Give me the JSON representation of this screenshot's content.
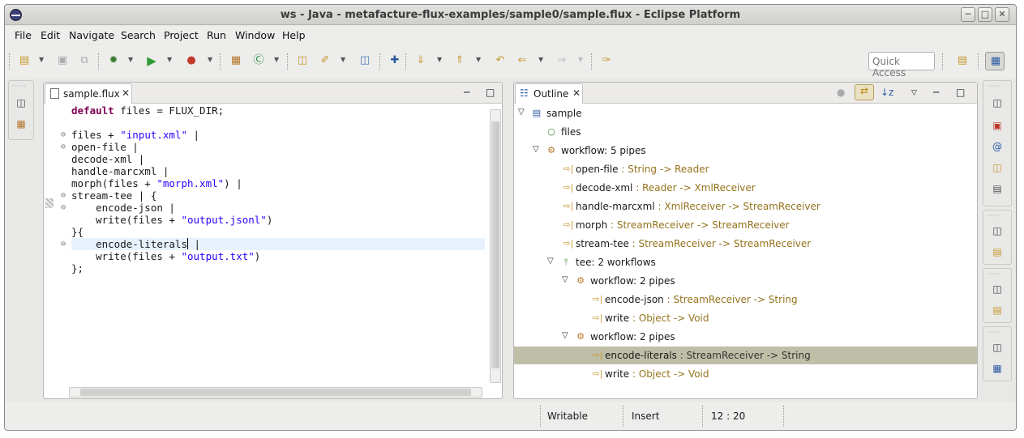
{
  "window": {
    "title": "ws - Java - metafacture-flux-examples/sample0/sample.flux - Eclipse Platform"
  },
  "menu": [
    "File",
    "Edit",
    "Navigate",
    "Search",
    "Project",
    "Run",
    "Window",
    "Help"
  ],
  "toolbar": {
    "quick_access_placeholder": "Quick Access"
  },
  "editor": {
    "tab_label": "sample.flux",
    "lines": [
      [
        {
          "t": "default",
          "c": "kw"
        },
        {
          "t": " files = FLUX_DIR;"
        }
      ],
      [],
      [
        {
          "t": "files + "
        },
        {
          "t": "\"input.xml\"",
          "c": "str"
        },
        {
          "t": " |"
        }
      ],
      [
        {
          "t": "open-file |"
        }
      ],
      [
        {
          "t": "decode-xml |"
        }
      ],
      [
        {
          "t": "handle-marcxml |"
        }
      ],
      [
        {
          "t": "morph(files + "
        },
        {
          "t": "\"morph.xml\"",
          "c": "str"
        },
        {
          "t": ") |"
        }
      ],
      [
        {
          "t": "stream-tee | {"
        }
      ],
      [
        {
          "t": "    encode-json |"
        }
      ],
      [
        {
          "t": "    write(files + "
        },
        {
          "t": "\"output.jsonl\"",
          "c": "str"
        },
        {
          "t": ")"
        }
      ],
      [
        {
          "t": "}{"
        }
      ],
      [
        {
          "t": "    encode-literals"
        },
        {
          "caret": true
        },
        {
          "t": " |"
        }
      ],
      [
        {
          "t": "    write(files + "
        },
        {
          "t": "\"output.txt\"",
          "c": "str"
        },
        {
          "t": ")"
        }
      ],
      [
        {
          "t": "};"
        }
      ]
    ]
  },
  "outline": {
    "tab_label": "Outline",
    "nodes": [
      {
        "depth": 0,
        "twisty": "open",
        "icon": "flux-file-icon",
        "name": "sample",
        "sig": ""
      },
      {
        "depth": 1,
        "twisty": "",
        "icon": "variable-icon",
        "name": "files",
        "sig": ""
      },
      {
        "depth": 1,
        "twisty": "open",
        "icon": "gears-icon",
        "name": "workflow: 5 pipes",
        "sig": ""
      },
      {
        "depth": 2,
        "twisty": "",
        "icon": "pipe-icon",
        "name": "open-file",
        "sig": " : String -> Reader"
      },
      {
        "depth": 2,
        "twisty": "",
        "icon": "pipe-icon",
        "name": "decode-xml",
        "sig": " : Reader -> XmlReceiver"
      },
      {
        "depth": 2,
        "twisty": "",
        "icon": "pipe-icon",
        "name": "handle-marcxml",
        "sig": " : XmlReceiver -> StreamReceiver"
      },
      {
        "depth": 2,
        "twisty": "",
        "icon": "pipe-icon",
        "name": "morph",
        "sig": " : StreamReceiver -> StreamReceiver"
      },
      {
        "depth": 2,
        "twisty": "",
        "icon": "pipe-icon",
        "name": "stream-tee",
        "sig": " : StreamReceiver -> StreamReceiver"
      },
      {
        "depth": 2,
        "twisty": "open",
        "icon": "tee-icon",
        "name": "tee: 2 workflows",
        "sig": ""
      },
      {
        "depth": 3,
        "twisty": "open",
        "icon": "gears-icon",
        "name": "workflow: 2 pipes",
        "sig": ""
      },
      {
        "depth": 4,
        "twisty": "",
        "icon": "pipe-icon",
        "name": "encode-json",
        "sig": " : StreamReceiver -> String"
      },
      {
        "depth": 4,
        "twisty": "",
        "icon": "pipe-icon",
        "name": "write",
        "sig": " : Object -> Void"
      },
      {
        "depth": 3,
        "twisty": "open",
        "icon": "gears-icon",
        "name": "workflow: 2 pipes",
        "sig": ""
      },
      {
        "depth": 4,
        "twisty": "",
        "icon": "pipe-icon",
        "name": "encode-literals",
        "sig": " : StreamReceiver -> String",
        "selected": true
      },
      {
        "depth": 4,
        "twisty": "",
        "icon": "pipe-icon",
        "name": "write",
        "sig": " : Object -> Void"
      }
    ]
  },
  "status": {
    "writable": "Writable",
    "mode": "Insert",
    "position": "12 : 20"
  }
}
